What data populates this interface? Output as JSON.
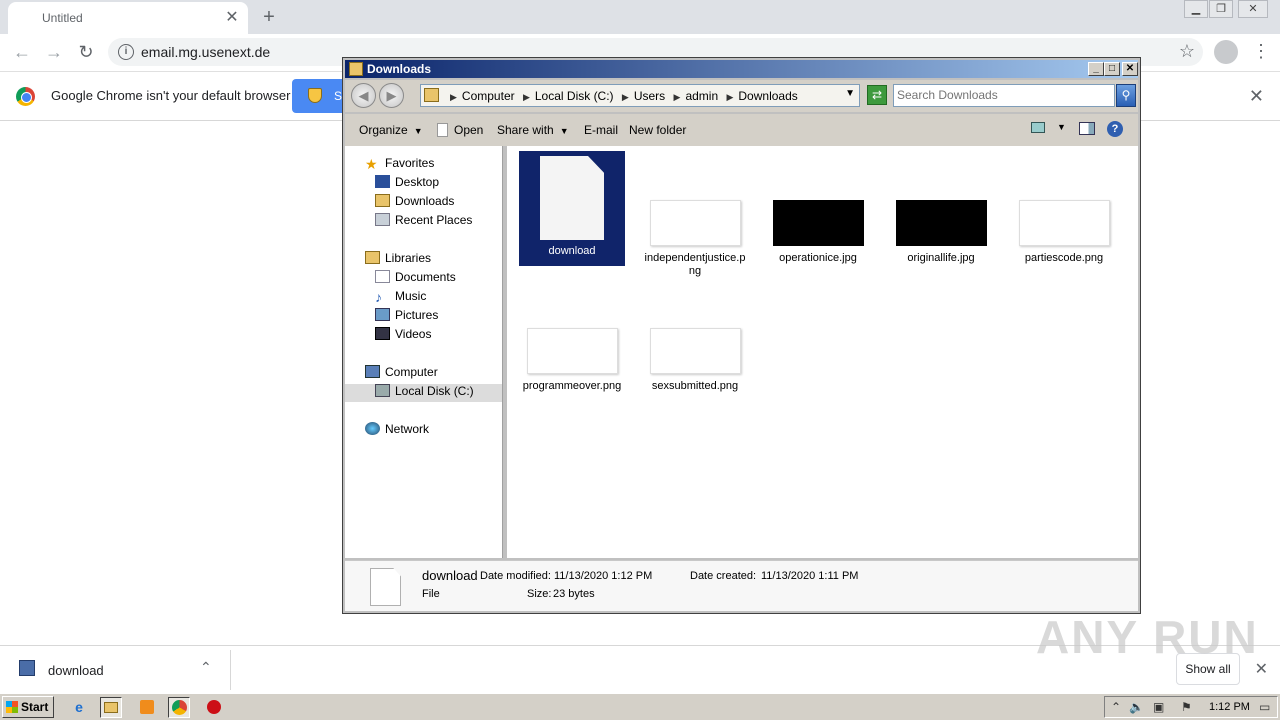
{
  "chrome": {
    "tab_title": "Untitled",
    "url": "email.mg.usenext.de",
    "infobar_message": "Google Chrome isn't your default browser",
    "infobar_button_label": "S",
    "download_filename": "download",
    "show_all_label": "Show all",
    "watermark": "ANY RUN"
  },
  "explorer": {
    "title": "Downloads",
    "breadcrumb": [
      "Computer",
      "Local Disk (C:)",
      "Users",
      "admin",
      "Downloads"
    ],
    "search_placeholder": "Search Downloads",
    "commands": {
      "organize": "Organize",
      "open": "Open",
      "share_with": "Share with",
      "email": "E-mail",
      "new_folder": "New folder"
    },
    "nav": {
      "favorites": "Favorites",
      "desktop": "Desktop",
      "downloads": "Downloads",
      "recent_places": "Recent Places",
      "libraries": "Libraries",
      "documents": "Documents",
      "music": "Music",
      "pictures": "Pictures",
      "videos": "Videos",
      "computer": "Computer",
      "local_disk": "Local Disk (C:)",
      "network": "Network"
    },
    "files": [
      {
        "name": "download",
        "kind": "generic-file",
        "selected": true
      },
      {
        "name": "independentjustice.png",
        "kind": "white-image"
      },
      {
        "name": "operationice.jpg",
        "kind": "black-image"
      },
      {
        "name": "originallife.jpg",
        "kind": "black-image"
      },
      {
        "name": "partiescode.png",
        "kind": "white-image"
      },
      {
        "name": "programmeover.png",
        "kind": "white-image"
      },
      {
        "name": "sexsubmitted.png",
        "kind": "white-image"
      }
    ],
    "details": {
      "name": "download",
      "type": "File",
      "date_modified_label": "Date modified:",
      "date_modified": "11/13/2020 1:12 PM",
      "date_created_label": "Date created:",
      "date_created": "11/13/2020 1:11 PM",
      "size_label": "Size:",
      "size": "23 bytes"
    }
  },
  "taskbar": {
    "start_label": "Start",
    "clock": "1:12 PM"
  },
  "colors": {
    "selection": "#10246a",
    "titlebar_start": "#0a246a",
    "titlebar_end": "#a6caf0",
    "chrome_blue": "#4a89f3"
  }
}
